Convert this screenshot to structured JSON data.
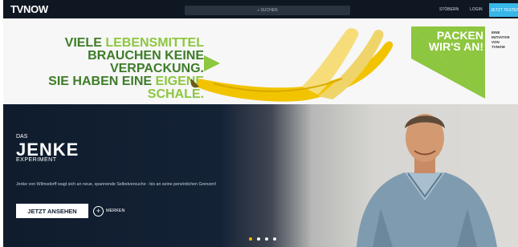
{
  "header": {
    "logo_tv": "TV",
    "logo_now": "NOW",
    "search_placeholder": "⌕ SUCHEN",
    "nav": [
      "STÖBERN",
      "LOGIN"
    ],
    "cta": "JETZT TESTEN"
  },
  "banner": {
    "line1_a": "VIELE ",
    "line1_b": "LEBENSMITTEL",
    "line2": "BRAUCHEN KEINE VERPACKUNG.",
    "line3_a": "SIE HABEN EINE ",
    "line3_b": "EIGENE SCHALE.",
    "badge": "PACKEN WIR'S AN!",
    "initiative_lines": [
      "EINE",
      "INITIATIVE",
      "VON",
      "TVNOW"
    ]
  },
  "hero": {
    "series_das": "DAS",
    "series_title": "JENKE",
    "series_sub": "EXPERIMENT",
    "description": "Jenke von Wilmsdorff wagt sich an neue, spannende Selbstversuche - bis an seine persönlichen Grenzen!",
    "watch_label": "JETZT ANSEHEN",
    "merken_icon": "+",
    "merken_label": "MERKEN"
  },
  "carousel": {
    "slides": 4,
    "active": 0
  },
  "colors": {
    "accent_green": "#8dc63f",
    "dark_green": "#3d7c28",
    "cta_blue": "#37b6e8",
    "hero_dark": "#101d2e",
    "dot_active": "#f5b400"
  }
}
